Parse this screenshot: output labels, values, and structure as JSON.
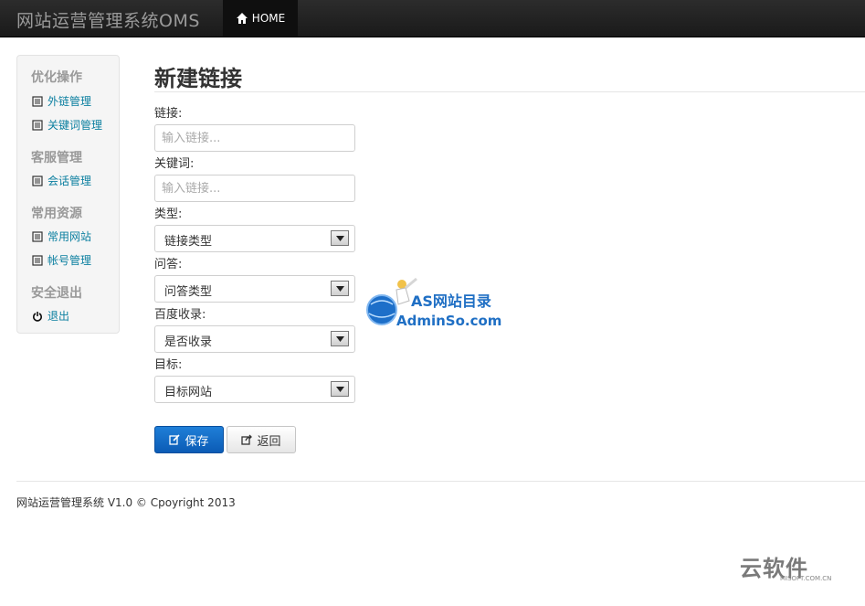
{
  "navbar": {
    "brand": "网站运营管理系统OMS",
    "home_label": "HOME"
  },
  "sidebar": {
    "groups": [
      {
        "title": "优化操作",
        "items": [
          {
            "label": "外链管理",
            "icon": "list-icon"
          },
          {
            "label": "关键词管理",
            "icon": "list-icon"
          }
        ]
      },
      {
        "title": "客服管理",
        "items": [
          {
            "label": "会话管理",
            "icon": "list-icon"
          }
        ]
      },
      {
        "title": "常用资源",
        "items": [
          {
            "label": "常用网站",
            "icon": "list-icon"
          },
          {
            "label": "帐号管理",
            "icon": "list-icon"
          }
        ]
      },
      {
        "title": "安全退出",
        "items": [
          {
            "label": "退出",
            "icon": "power-icon"
          }
        ]
      }
    ]
  },
  "main": {
    "title": "新建链接",
    "fields": {
      "link": {
        "label": "链接:",
        "placeholder": "输入链接...",
        "value": ""
      },
      "keyword": {
        "label": "关键词:",
        "placeholder": "输入链接...",
        "value": ""
      },
      "type": {
        "label": "类型:",
        "selected": "链接类型"
      },
      "qa": {
        "label": "问答:",
        "selected": "问答类型"
      },
      "baidu": {
        "label": "百度收录:",
        "selected": "是否收录"
      },
      "target": {
        "label": "目标:",
        "selected": "目标网站"
      }
    },
    "buttons": {
      "save": "保存",
      "back": "返回"
    }
  },
  "footer": {
    "text": "网站运营管理系统 V1.0 © Cpoyright 2013"
  },
  "watermarks": {
    "admin_title": "AS网站目录",
    "admin_url": "AdminSo.com",
    "soft_name": "云软件",
    "soft_url": "MISOFT.COM.CN"
  },
  "colors": {
    "primary": "#0b5bb5",
    "link": "#0b7fa0",
    "navbar": "#1f1f1f"
  }
}
